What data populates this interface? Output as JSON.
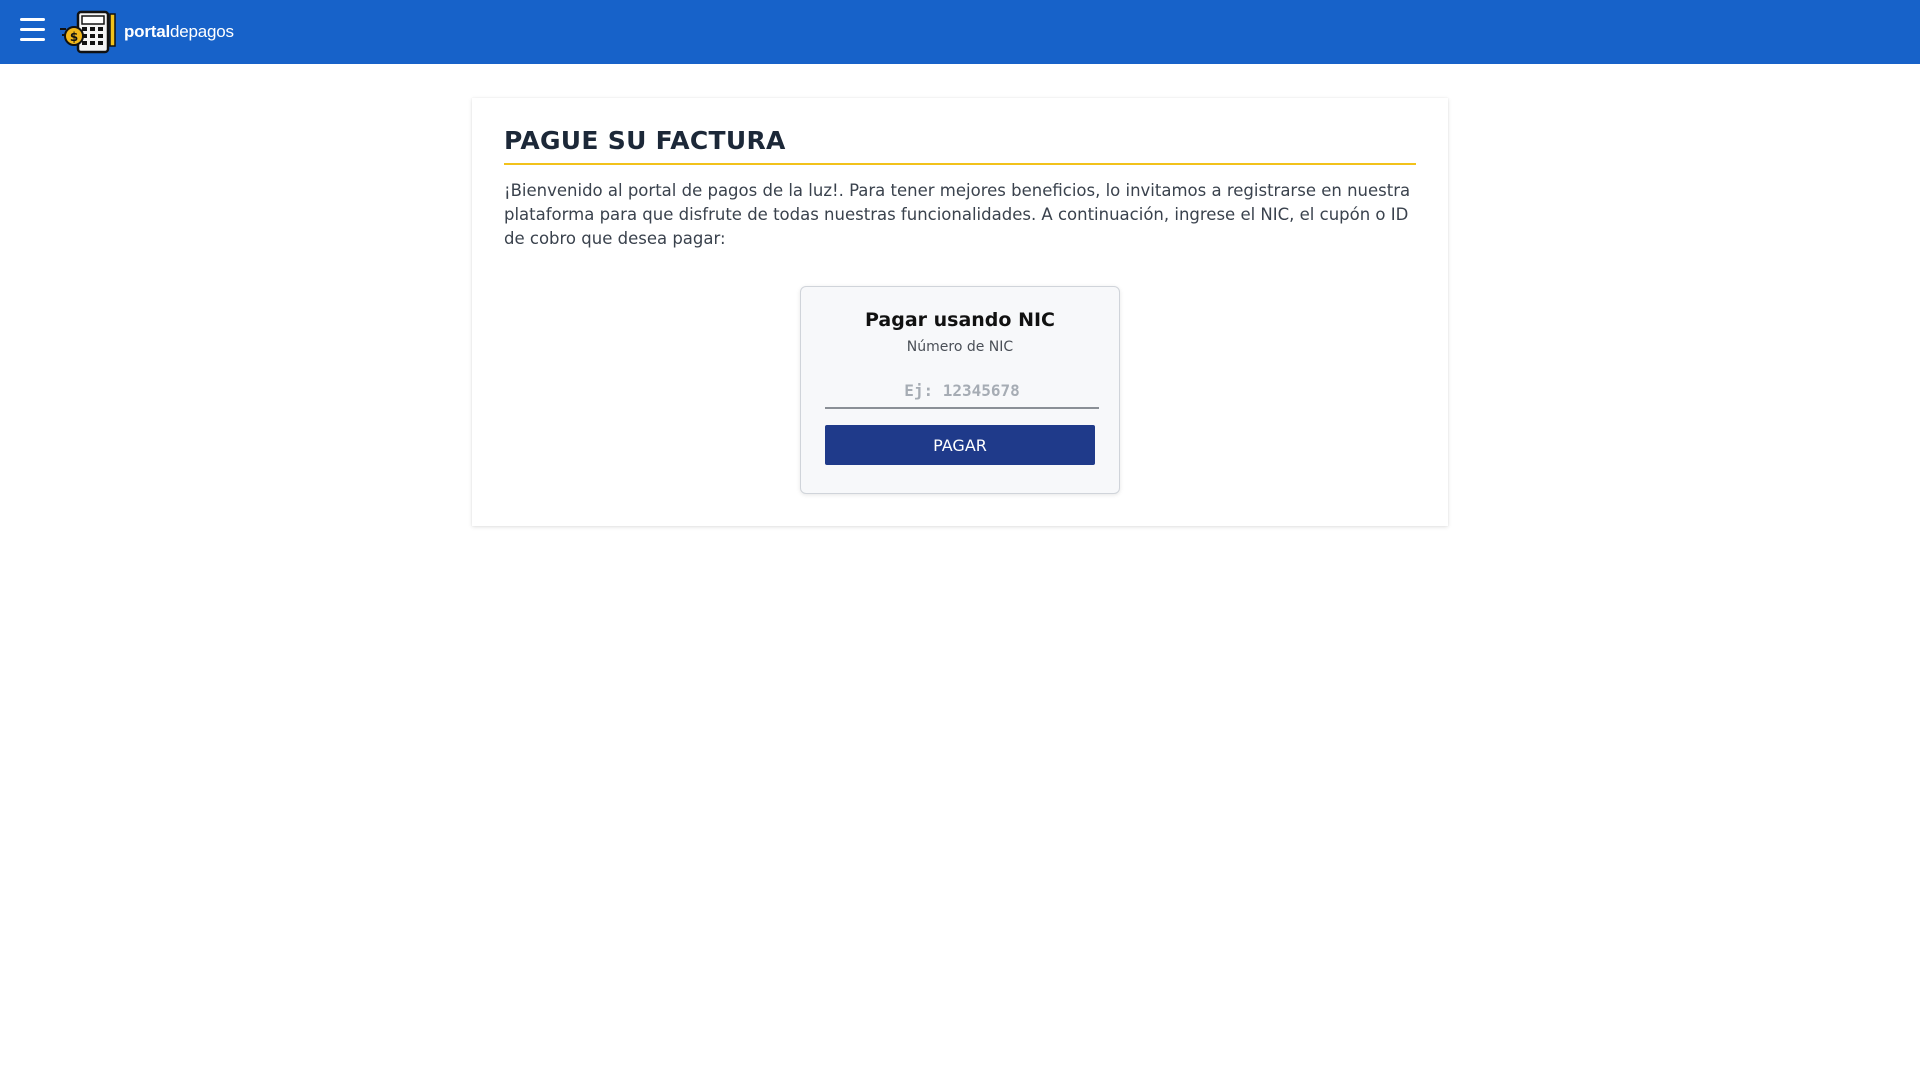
{
  "header": {
    "logo_bold": "portal",
    "logo_light": "depagos",
    "menu_icon": "hamburger-menu-icon",
    "logo_icon": "calculator-coin-icon",
    "bg_color": "#1762c9"
  },
  "main": {
    "title": "PAGUE SU FACTURA",
    "intro": "¡Bienvenido al portal de pagos de la luz!. Para tener mejores beneficios, lo invitamos a registrarse en nuestra plataforma para que disfrute de todas nuestras funcionalidades. A continuación, ingrese el NIC, el cupón o ID de cobro que desea pagar:",
    "accent_color": "#f2c21b"
  },
  "payment": {
    "title": "Pagar usando NIC",
    "label": "Número de NIC",
    "value": "",
    "placeholder": "Ej: 12345678",
    "button_label": "PAGAR",
    "button_color": "#1f3a8a"
  }
}
